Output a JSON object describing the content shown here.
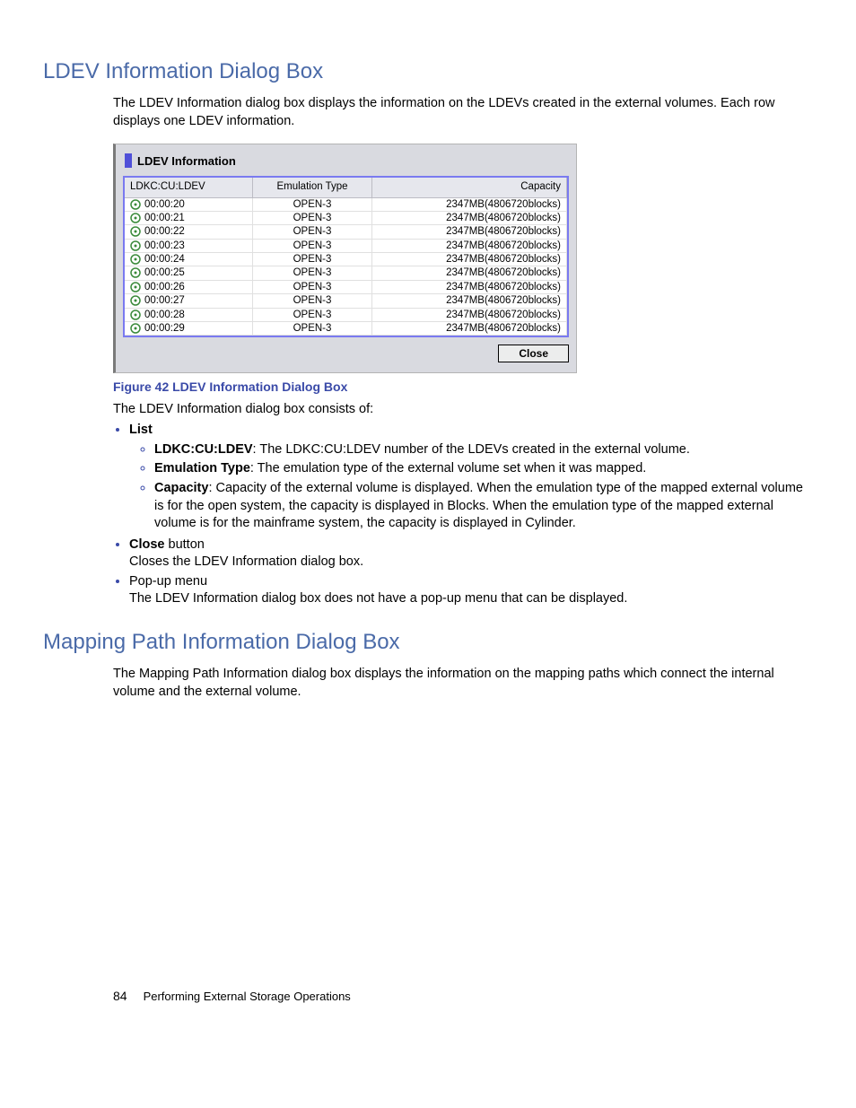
{
  "section1": {
    "heading": "LDEV Information Dialog Box",
    "intro": "The LDEV Information dialog box displays the information on the LDEVs created in the external volumes. Each row displays one LDEV information."
  },
  "dialog": {
    "title": "LDEV Information",
    "columns": [
      "LDKC:CU:LDEV",
      "Emulation Type",
      "Capacity"
    ],
    "rows": [
      {
        "ldev": "00:00:20",
        "emu": "OPEN-3",
        "cap": "2347MB(4806720blocks)"
      },
      {
        "ldev": "00:00:21",
        "emu": "OPEN-3",
        "cap": "2347MB(4806720blocks)"
      },
      {
        "ldev": "00:00:22",
        "emu": "OPEN-3",
        "cap": "2347MB(4806720blocks)"
      },
      {
        "ldev": "00:00:23",
        "emu": "OPEN-3",
        "cap": "2347MB(4806720blocks)"
      },
      {
        "ldev": "00:00:24",
        "emu": "OPEN-3",
        "cap": "2347MB(4806720blocks)"
      },
      {
        "ldev": "00:00:25",
        "emu": "OPEN-3",
        "cap": "2347MB(4806720blocks)"
      },
      {
        "ldev": "00:00:26",
        "emu": "OPEN-3",
        "cap": "2347MB(4806720blocks)"
      },
      {
        "ldev": "00:00:27",
        "emu": "OPEN-3",
        "cap": "2347MB(4806720blocks)"
      },
      {
        "ldev": "00:00:28",
        "emu": "OPEN-3",
        "cap": "2347MB(4806720blocks)"
      },
      {
        "ldev": "00:00:29",
        "emu": "OPEN-3",
        "cap": "2347MB(4806720blocks)"
      }
    ],
    "close_label": "Close"
  },
  "figure_caption": "Figure 42 LDEV Information Dialog Box",
  "consists_of_intro": "The LDEV Information dialog box consists of:",
  "list": {
    "list_label": "List",
    "items": {
      "ldkc": {
        "term": "LDKC:CU:LDEV",
        "desc": ": The LDKC:CU:LDEV number of the LDEVs created in the external volume."
      },
      "emu": {
        "term": "Emulation Type",
        "desc": ": The emulation type of the external volume set when it was mapped."
      },
      "cap": {
        "term": "Capacity",
        "desc": ": Capacity of the external volume is displayed. When the emulation type of the mapped external volume is for the open system, the capacity is displayed in Blocks. When the emulation type of the mapped external volume is for the mainframe system, the capacity is displayed in Cylinder."
      }
    },
    "close": {
      "term": "Close",
      "suffix": " button",
      "desc": "Closes the LDEV Information dialog box."
    },
    "popup": {
      "term": "Pop-up menu",
      "desc": "The LDEV Information dialog box does not have a pop-up menu that can be displayed."
    }
  },
  "section2": {
    "heading": "Mapping Path Information Dialog Box",
    "intro": "The Mapping Path Information dialog box displays the information on the mapping paths which connect the internal volume and the external volume."
  },
  "footer": {
    "page": "84",
    "title": "Performing External Storage Operations"
  }
}
